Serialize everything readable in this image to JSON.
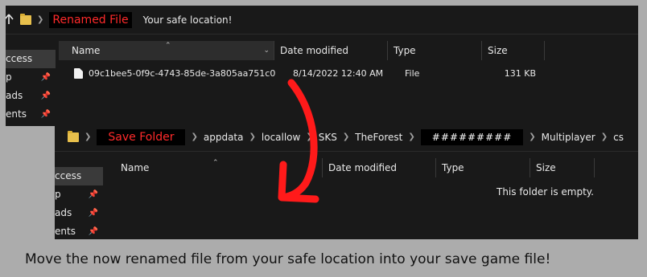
{
  "top_explorer": {
    "address": {
      "highlight": "Renamed File",
      "location": "Your safe location!"
    },
    "nav": [
      {
        "label": "ccess",
        "pinned": false,
        "selected": true
      },
      {
        "label": "p",
        "pinned": true,
        "selected": false
      },
      {
        "label": "ads",
        "pinned": true,
        "selected": false
      },
      {
        "label": "ents",
        "pinned": true,
        "selected": false
      }
    ],
    "columns": {
      "name": "Name",
      "date": "Date modified",
      "type": "Type",
      "size": "Size"
    },
    "file": {
      "name": "09c1bee5-0f9c-4743-85de-3a805aa751c0",
      "date": "8/14/2022 12:40 AM",
      "type": "File",
      "size": "131 KB"
    }
  },
  "bottom_explorer": {
    "address": {
      "highlight": "Save Folder",
      "crumbs": [
        "appdata",
        "locallow",
        "SKS",
        "TheForest",
        "#########",
        "Multiplayer",
        "cs"
      ]
    },
    "nav": [
      {
        "label": "ccess",
        "pinned": false,
        "selected": true
      },
      {
        "label": "p",
        "pinned": true,
        "selected": false
      },
      {
        "label": "ads",
        "pinned": true,
        "selected": false
      },
      {
        "label": "ents",
        "pinned": true,
        "selected": false
      }
    ],
    "columns": {
      "name": "Name",
      "date": "Date modified",
      "type": "Type",
      "size": "Size"
    },
    "empty_message": "This folder is empty."
  },
  "caption": "Move the now renamed file from your safe location into your save game file!",
  "colors": {
    "highlight_text": "#ff2a2a",
    "arrow": "#ff1a1a",
    "explorer_bg": "#191919",
    "page_bg": "#acacac"
  },
  "icons": [
    "folder-icon",
    "breadcrumb-chevron-icon",
    "pin-icon",
    "file-icon",
    "sort-caret-icon",
    "up-arrow-icon"
  ]
}
